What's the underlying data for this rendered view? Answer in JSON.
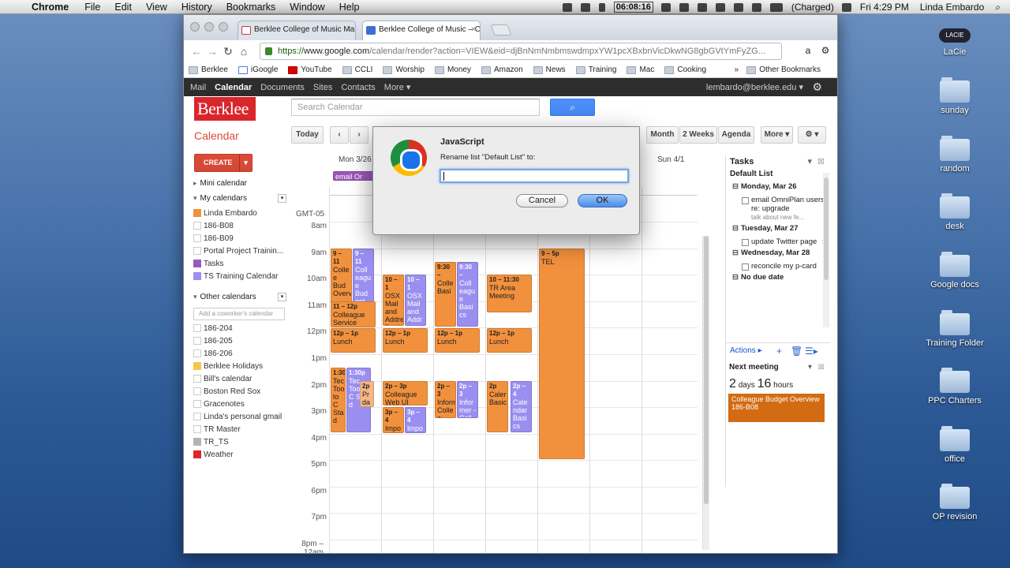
{
  "menubar": {
    "app": "Chrome",
    "items": [
      "File",
      "Edit",
      "View",
      "History",
      "Bookmarks",
      "Window",
      "Help"
    ],
    "time_meter": "06:08:16",
    "battery": "(Charged)",
    "clock": "Fri 4:29 PM",
    "user": "Linda Embardo"
  },
  "desktop": {
    "drive": "LaCie",
    "drive_badge": "LACIE",
    "folders": [
      "sunday",
      "random",
      "desk",
      "Google docs",
      "Training Folder",
      "PPC Charters",
      "office",
      "OP revision"
    ]
  },
  "browser": {
    "tabs": [
      "Berklee College of Music Ma",
      "Berklee College of Music – C"
    ],
    "url_scheme": "https://",
    "url_host": "www.google.com",
    "url_path": "/calendar/render?action=VIEW&eid=djBnNmNmbmswdmpxYW1pcXBxbnVicDkwNG8gbGVtYmFyZG...",
    "bookmarks": [
      "Berklee",
      "iGoogle",
      "YouTube",
      "CCLI",
      "Worship",
      "Money",
      "Amazon",
      "News",
      "Training",
      "Mac",
      "Cooking"
    ],
    "other_bookmarks": "Other Bookmarks"
  },
  "gbar": {
    "items": [
      "Mail",
      "Calendar",
      "Documents",
      "Sites",
      "Contacts",
      "More ▾"
    ],
    "account": "lembardo@berklee.edu ▾"
  },
  "calendar": {
    "logo": "Berklee",
    "search_placeholder": "Search Calendar",
    "title": "Calendar",
    "today": "Today",
    "views": [
      "Month",
      "2 Weeks",
      "Agenda",
      "More ▾"
    ],
    "create": "CREATE",
    "timezone": "GMT-05",
    "day_first": "Mon 3/26",
    "day_last": "Sun 4/1",
    "allday_event": "email Or",
    "hours": [
      "8am",
      "9am",
      "10am",
      "11am",
      "12pm",
      "1pm",
      "2pm",
      "3pm",
      "4pm",
      "5pm",
      "6pm",
      "7pm",
      "8pm – 12am"
    ],
    "events": [
      {
        "t": "9 – 11",
        "n": "Colle e Bud Overv"
      },
      {
        "t": "9 – 11",
        "n": "Coll eagu e Bud get"
      },
      {
        "t": "11 – 12p",
        "n": "Colleague Service"
      },
      {
        "t": "12p – 1p",
        "n": "Lunch"
      },
      {
        "t": "1:30p",
        "n": "Tec Too to C Sta d"
      },
      {
        "t": "1:30p",
        "n": "Tec Too to C Sta d"
      },
      {
        "t": "2p",
        "n": "Pr da"
      },
      {
        "t": "10 – 1",
        "n": "OSX Mail and Addre Book"
      },
      {
        "t": "10 – 1",
        "n": "OSX Mail and Addr ess"
      },
      {
        "t": "12p – 1p",
        "n": "Lunch"
      },
      {
        "t": "2p – 3p",
        "n": "Colleague Web UI"
      },
      {
        "t": "3p – 4",
        "n": "Impo Meeti"
      },
      {
        "t": "3p – 4",
        "n": "Impo rtant"
      },
      {
        "t": "9:30 –",
        "n": "Colle Basi"
      },
      {
        "t": "9:30 –",
        "n": "Coll eagu e Basi cs"
      },
      {
        "t": "12p – 1p",
        "n": "Lunch"
      },
      {
        "t": "2p – 3",
        "n": "Inform Colle e Depa"
      },
      {
        "t": "2p – 3",
        "n": "Infor mer - Coll eagu"
      },
      {
        "t": "10 – 11:30",
        "n": "TR Area Meeting"
      },
      {
        "t": "12p – 1p",
        "n": "Lunch"
      },
      {
        "t": "2p",
        "n": "Caler Basic"
      },
      {
        "t": "2p – 4",
        "n": "Cale ndar Basi cs"
      },
      {
        "t": "9 – 5p",
        "n": "TEL"
      }
    ]
  },
  "sidebar": {
    "mini": "Mini calendar",
    "my": "My calendars",
    "my_list": [
      {
        "name": "Linda Embardo",
        "color": "#f2913d"
      },
      {
        "name": "186-B08",
        "color": ""
      },
      {
        "name": "186-B09",
        "color": ""
      },
      {
        "name": "Portal Project Trainin...",
        "color": ""
      },
      {
        "name": "Tasks",
        "color": "#9b58b8"
      },
      {
        "name": "TS Training Calendar",
        "color": "#9a8ff0"
      }
    ],
    "other": "Other calendars",
    "add_placeholder": "Add a coworker's calendar",
    "other_list": [
      {
        "name": "186-204",
        "color": ""
      },
      {
        "name": "186-205",
        "color": ""
      },
      {
        "name": "186-206",
        "color": ""
      },
      {
        "name": "Berklee Holidays",
        "color": "#f4c84b"
      },
      {
        "name": "Bill's calendar",
        "color": ""
      },
      {
        "name": "Boston Red Sox",
        "color": ""
      },
      {
        "name": "Gracenotes",
        "color": ""
      },
      {
        "name": "Linda's personal gmail",
        "color": ""
      },
      {
        "name": "TR Master",
        "color": ""
      },
      {
        "name": "TR_TS",
        "color": "#b8b1b1"
      },
      {
        "name": "Weather",
        "color": "#e0232b"
      }
    ]
  },
  "tasks": {
    "title": "Tasks",
    "list": "Default List",
    "g1": "Monday, Mar 26",
    "i1": "email OmniPlan users re: upgrade",
    "i1sub": "talk about new fe...",
    "g2": "Tuesday, Mar 27",
    "i2": "update Twitter page",
    "g3": "Wednesday, Mar 28",
    "i3": "reconcile my p-card",
    "g4": "No due date",
    "actions": "Actions ▸"
  },
  "next": {
    "title": "Next meeting",
    "days": "2",
    "days_lbl": "days",
    "hours": "16",
    "hours_lbl": "hours",
    "card_title": "Colleague Budget Overview",
    "card_room": "186-B08"
  },
  "dialog": {
    "title": "JavaScript",
    "message": "Rename list \"Default List\" to:",
    "value": "",
    "cancel": "Cancel",
    "ok": "OK"
  }
}
